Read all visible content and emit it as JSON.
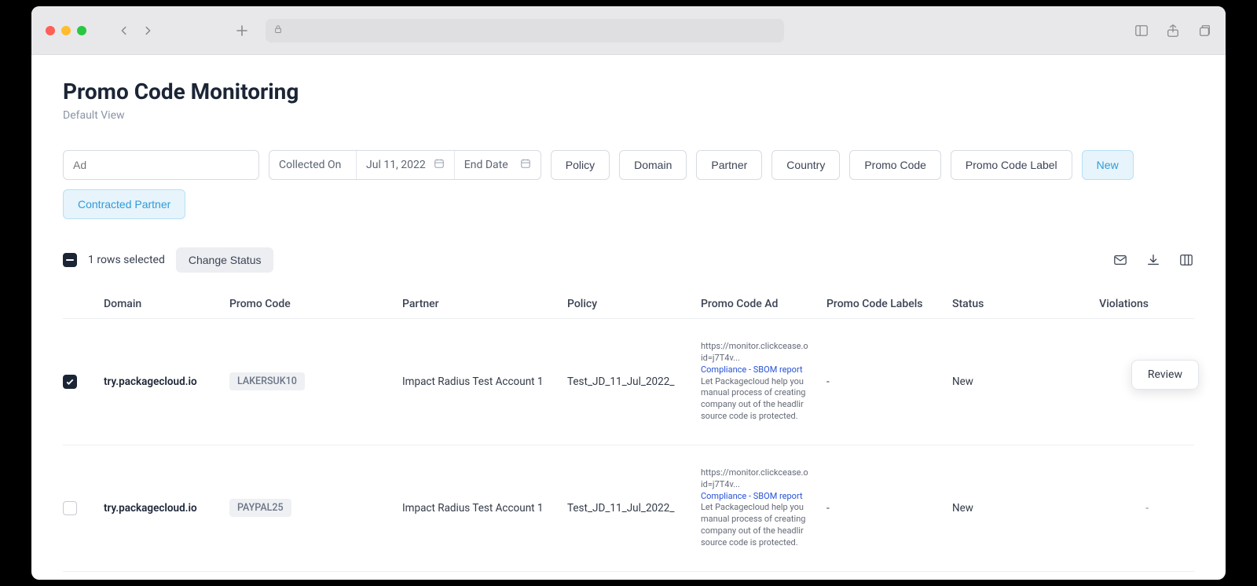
{
  "chrome": {},
  "page": {
    "title": "Promo Code Monitoring",
    "subtitle": "Default View"
  },
  "filters": {
    "ad_placeholder": "Ad",
    "collected_on_label": "Collected On",
    "start_date": "Jul 11, 2022",
    "end_date_label": "End Date",
    "buttons": [
      "Policy",
      "Domain",
      "Partner",
      "Country",
      "Promo Code",
      "Promo Code Label"
    ],
    "active_buttons": [
      "New",
      "Contracted Partner"
    ]
  },
  "selection": {
    "text": "1 rows selected",
    "change_status_label": "Change Status"
  },
  "columns": {
    "domain": "Domain",
    "promo_code": "Promo Code",
    "partner": "Partner",
    "policy": "Policy",
    "promo_code_ad": "Promo Code Ad",
    "promo_code_labels": "Promo Code Labels",
    "status": "Status",
    "violations": "Violations"
  },
  "rows": [
    {
      "checked": true,
      "domain": "try.packagecloud.io",
      "code": "LAKERSUK10",
      "partner": "Impact Radius Test Account 1",
      "policy": "Test_JD_11_Jul_2022_",
      "ad_url": "https://monitor.clickcease.o id=j7T4v...",
      "ad_link": "Compliance - SBOM report",
      "ad_desc": "Let Packagecloud help you manual process of creating company out of the headlir source code is protected.",
      "labels": "-",
      "status": "New",
      "violations": "-"
    },
    {
      "checked": false,
      "domain": "try.packagecloud.io",
      "code": "PAYPAL25",
      "partner": "Impact Radius Test Account 1",
      "policy": "Test_JD_11_Jul_2022_",
      "ad_url": "https://monitor.clickcease.o id=j7T4v...",
      "ad_link": "Compliance - SBOM report",
      "ad_desc": "Let Packagecloud help you manual process of creating company out of the headlir source code is protected.",
      "labels": "-",
      "status": "New",
      "violations": "-"
    }
  ],
  "menu": {
    "review": "Review"
  }
}
